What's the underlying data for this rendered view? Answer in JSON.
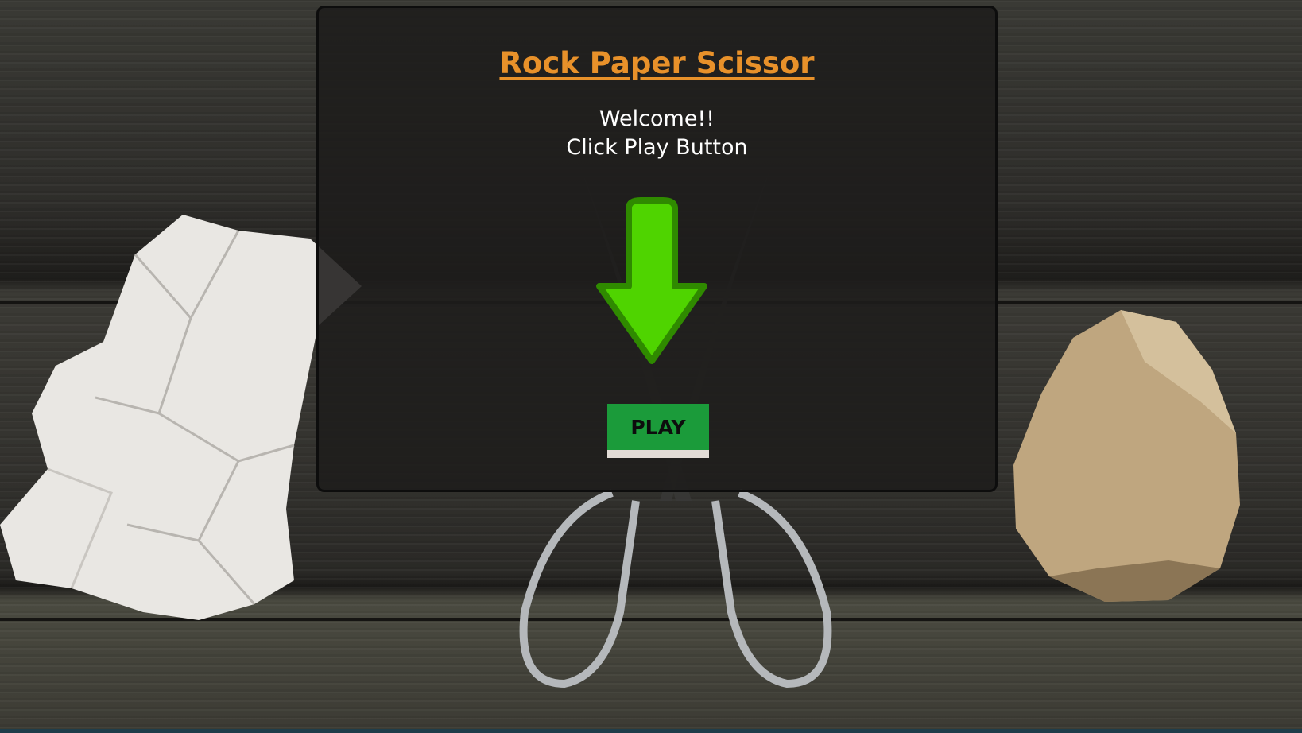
{
  "game": {
    "title": "Rock Paper Scissor",
    "welcome": "Welcome!!",
    "instruction": "Click Play Button",
    "play_label": "PLAY"
  },
  "icons": {
    "arrow": "down-arrow-icon",
    "background": [
      "paper",
      "scissors",
      "rock"
    ]
  },
  "colors": {
    "title": "#e8912a",
    "play_button": "#1b9b3a",
    "arrow": "#4fd400"
  }
}
